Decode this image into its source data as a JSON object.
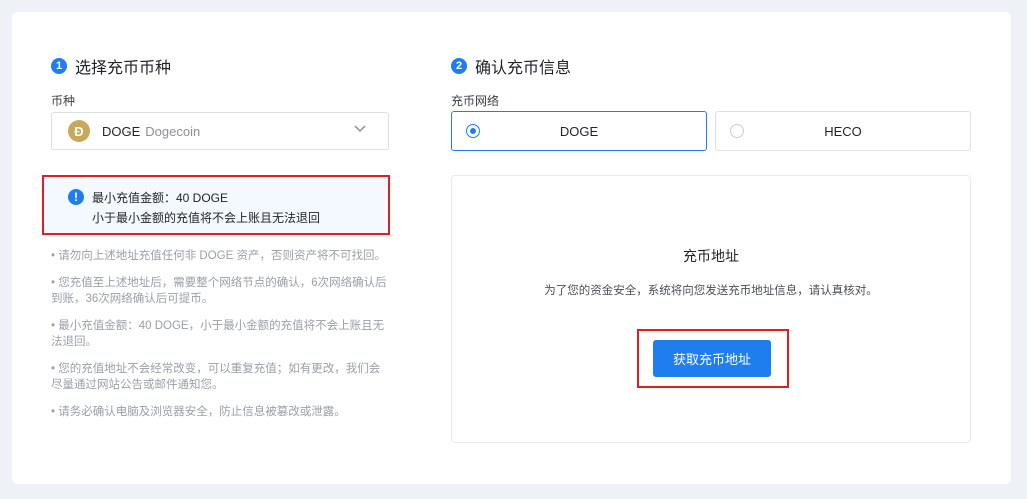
{
  "step1": {
    "number": "1",
    "title": "选择充币币种"
  },
  "coin_field": {
    "label": "币种",
    "coin_icon_glyph": "Ð",
    "symbol": "DOGE",
    "name": "Dogecoin"
  },
  "notice": {
    "icon": "!",
    "line1": "最小充值金额：40 DOGE",
    "line2": "小于最小金额的充值将不会上账且无法退回"
  },
  "tips": [
    "• 请勿向上述地址充值任何非 DOGE 资产，否则资产将不可找回。",
    "• 您充值至上述地址后，需要整个网络节点的确认，6次网络确认后到账，36次网络确认后可提币。",
    "• 最小充值金额：40 DOGE，小于最小金额的充值将不会上账且无法退回。",
    "• 您的充值地址不会经常改变，可以重复充值；如有更改，我们会尽量通过网站公告或邮件通知您。",
    "• 请务必确认电脑及浏览器安全，防止信息被篡改或泄露。"
  ],
  "step2": {
    "number": "2",
    "title": "确认充币信息"
  },
  "network_field": {
    "label": "充币网络",
    "options": [
      {
        "label": "DOGE",
        "selected": true
      },
      {
        "label": "HECO",
        "selected": false
      }
    ]
  },
  "address_panel": {
    "title": "充币地址",
    "description": "为了您的资金安全，系统将向您发送充币地址信息，请认真核对。",
    "button_label": "获取充币地址"
  },
  "colors": {
    "accent": "#1e7ef0",
    "highlight_border": "#e02020",
    "coin": "#c8a85a"
  },
  "icons": [
    "step-number-icon",
    "dogecoin-icon",
    "chevron-down-icon",
    "info-icon",
    "radio-icon"
  ]
}
